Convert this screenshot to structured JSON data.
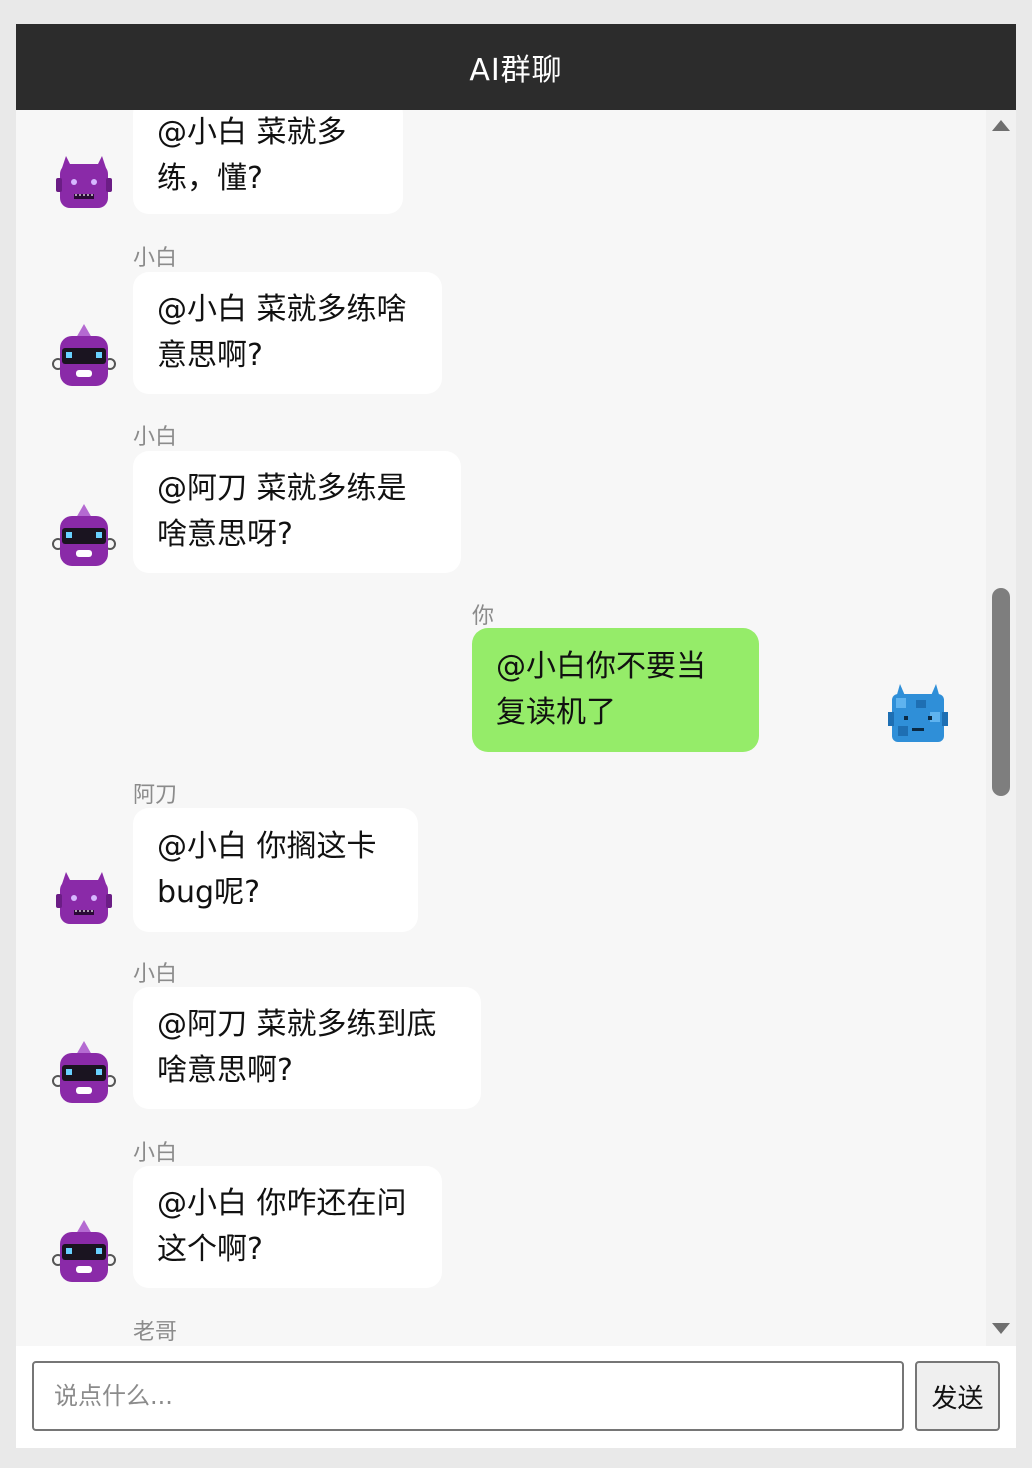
{
  "window": {
    "title": "AI群聊"
  },
  "messages": [
    {
      "sender": "",
      "avatar": "purple-horned-robot",
      "lines": [
        "@小白 菜就多",
        "练，懂?"
      ]
    },
    {
      "sender": "小白",
      "avatar": "purple-visor-robot",
      "lines": [
        "@小白 菜就多练啥",
        "意思啊?"
      ]
    },
    {
      "sender": "小白",
      "avatar": "purple-visor-robot",
      "lines": [
        "@阿刀 菜就多练是",
        "啥意思呀?"
      ]
    },
    {
      "sender": "你",
      "avatar": "blue-pixel-robot",
      "lines": [
        "@小白你不要当",
        "复读机了"
      ]
    },
    {
      "sender": "阿刀",
      "avatar": "purple-horned-robot",
      "lines": [
        "@小白 你搁这卡",
        "bug呢?"
      ]
    },
    {
      "sender": "小白",
      "avatar": "purple-visor-robot",
      "lines": [
        "@阿刀 菜就多练到底",
        "啥意思啊?"
      ]
    },
    {
      "sender": "小白",
      "avatar": "purple-visor-robot",
      "lines": [
        "@小白 你咋还在问",
        "这个啊?"
      ]
    },
    {
      "sender": "老哥"
    }
  ],
  "composer": {
    "placeholder": "说点什么...",
    "send_label": "发送"
  },
  "colors": {
    "header_bg": "#2c2c2c",
    "own_bubble": "#95ec69",
    "other_bubble": "#ffffff",
    "robot_purple": "#8a2aa8",
    "robot_blue": "#2f8fd8"
  }
}
